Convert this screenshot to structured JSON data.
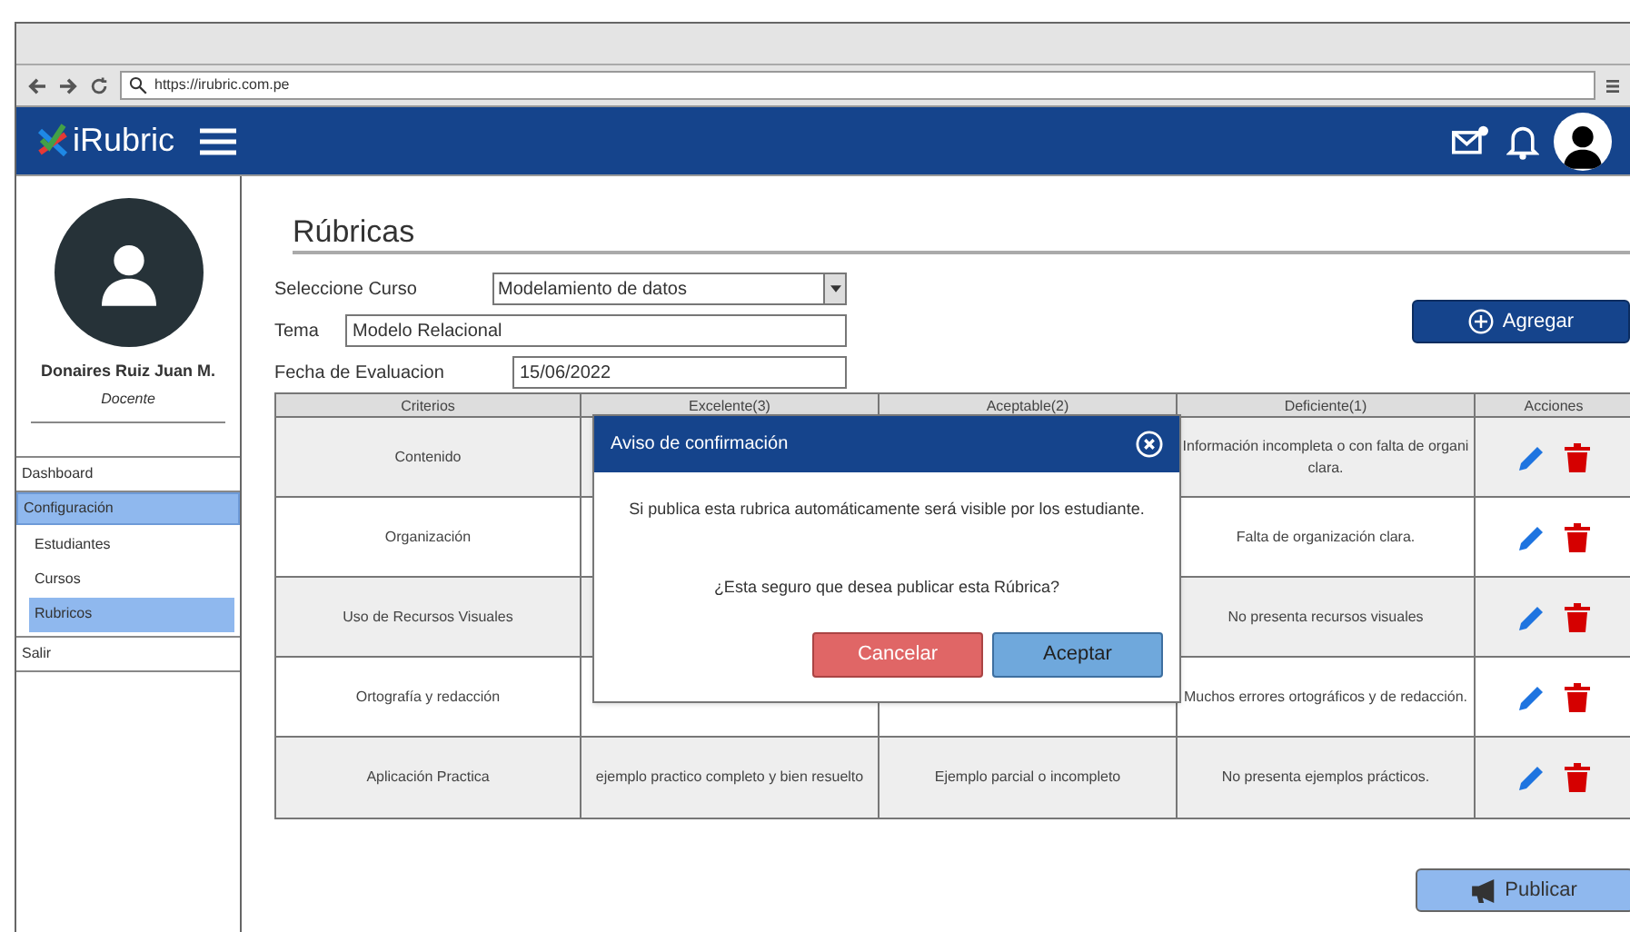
{
  "browser": {
    "url": "https://irubric.com.pe"
  },
  "header": {
    "logo": "iRubric"
  },
  "sidebar": {
    "user_name": "Donaires Ruiz Juan M.",
    "role": "Docente",
    "nav": [
      {
        "label": "Dashboard",
        "selected": false
      },
      {
        "label": "Configuración",
        "selected": true,
        "children": [
          {
            "label": "Estudiantes",
            "selected": false
          },
          {
            "label": "Cursos",
            "selected": false
          },
          {
            "label": "Rubricos",
            "selected": true
          }
        ]
      },
      {
        "label": "Salir",
        "selected": false
      }
    ]
  },
  "page": {
    "title": "Rúbricas",
    "course_label": "Seleccione Curso",
    "course_value": "Modelamiento de datos",
    "topic_label": "Tema",
    "topic_value": "Modelo Relacional",
    "date_label": "Fecha de Evaluacion",
    "date_value": "15/06/2022",
    "add_button": "Agregar",
    "table": {
      "columns": [
        "Criterios",
        "Excelente(3)",
        "Aceptable(2)",
        "Deficiente(1)",
        "Acciones"
      ],
      "rows": [
        {
          "criterion": "Contenido",
          "deficient": "Información incompleta o con falta de organi clara."
        },
        {
          "criterion": "Organización",
          "deficient": "Falta de organización clara."
        },
        {
          "criterion": "Uso de Recursos Visuales",
          "deficient": "No presenta recursos visuales"
        },
        {
          "criterion": "Ortografía y redacción",
          "deficient": "Muchos errores ortográficos y de redacción."
        },
        {
          "criterion": "Aplicación Practica",
          "excellent": "ejemplo practico completo y bien resuelto",
          "acceptable": "Ejemplo parcial o incompleto",
          "deficient": "No presenta ejemplos prácticos."
        }
      ]
    },
    "publish_button": "Publicar"
  },
  "dialog": {
    "title": "Aviso de confirmación",
    "message": "Si publica esta rubrica automáticamente será visible por los estudiante.",
    "question": "¿Esta seguro que desea publicar esta Rúbrica?",
    "cancel": "Cancelar",
    "accept": "Aceptar"
  }
}
